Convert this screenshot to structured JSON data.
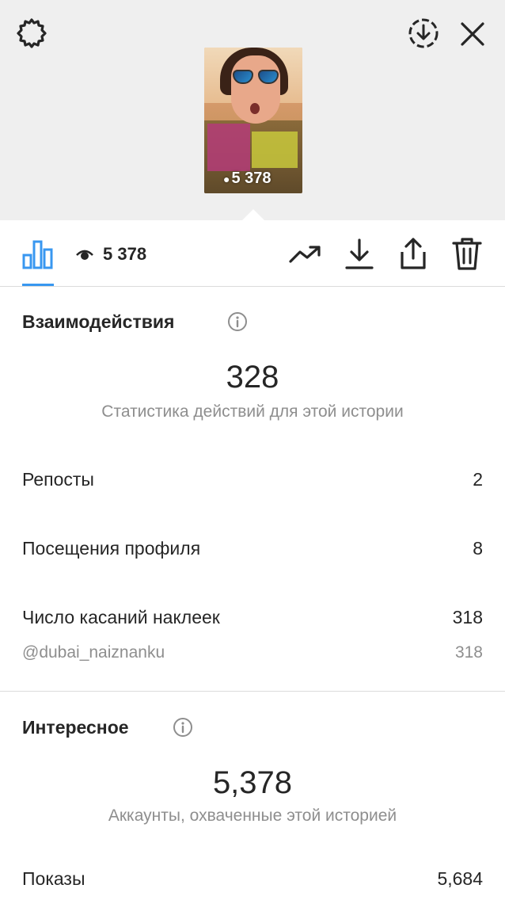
{
  "story": {
    "thumbnail_views": "5 378"
  },
  "toolbar": {
    "view_count": "5 378"
  },
  "interactions": {
    "title": "Взаимодействия",
    "total": "328",
    "total_caption": "Статистика действий для этой истории",
    "rows": [
      {
        "label": "Репосты",
        "value": "2"
      },
      {
        "label": "Посещения профиля",
        "value": "8"
      },
      {
        "label": "Число касаний наклеек",
        "value": "318"
      }
    ],
    "sub_row": {
      "label": "@dubai_naiznanku",
      "value": "318"
    }
  },
  "discovery": {
    "title": "Интересное",
    "total": "5,378",
    "total_caption": "Аккаунты, охваченные этой историей",
    "rows": [
      {
        "label": "Показы",
        "value": "5,684"
      }
    ]
  },
  "colors": {
    "accent": "#3897f0",
    "text": "#262626",
    "secondary_text": "#8e8e8e",
    "header_bg": "#efefef"
  },
  "icons": {
    "settings": "gear-icon",
    "download_story": "circle-download-icon",
    "close": "close-icon",
    "insights": "bar-chart-icon",
    "views": "eye-icon",
    "promote": "trending-up-icon",
    "save": "download-icon",
    "share": "share-icon",
    "delete": "trash-icon",
    "info": "info-icon"
  }
}
